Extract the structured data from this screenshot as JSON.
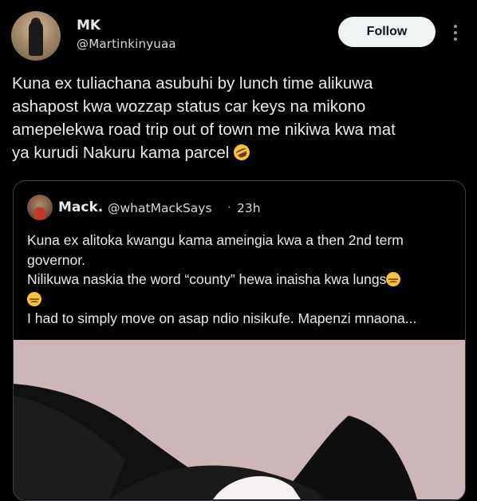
{
  "tweet": {
    "author": {
      "display_name": "MK",
      "handle": "@Martinkinyuaa"
    },
    "follow_label": "Follow",
    "more_icon": "more-options-icon",
    "text_lines": [
      "Kuna ex tuliachana asubuhi by lunch time alikuwa",
      "ashapost kwa wozzap status car keys na mikono",
      "amepelekwa road trip out of town me nikiwa kwa mat",
      "ya kurudi Nakuru kama parcel"
    ],
    "text_emoji": "rolling-on-floor-laughing-emoji"
  },
  "quoted_tweet": {
    "display_name": "Mack.",
    "handle": "@whatMackSays",
    "separator": "·",
    "time": "23h",
    "text_lines": [
      "Kuna ex alitoka kwangu kama ameingia kwa a then 2nd term",
      "governor.",
      "Nilikuwa naskia the word “county” hewa inaisha kwa lungs",
      "I had to simply move on asap ndio nisikufe. Mapenzi mnaona..."
    ],
    "emoji": "disappointed-face-emoji",
    "image_subject": "cat photo"
  },
  "colors": {
    "background": "#000000",
    "text": "#e7e9ea",
    "secondary_text": "#d9d9d9",
    "border": "#3a3f44",
    "follow_bg": "#eff3f4",
    "follow_text": "#0f1419"
  }
}
